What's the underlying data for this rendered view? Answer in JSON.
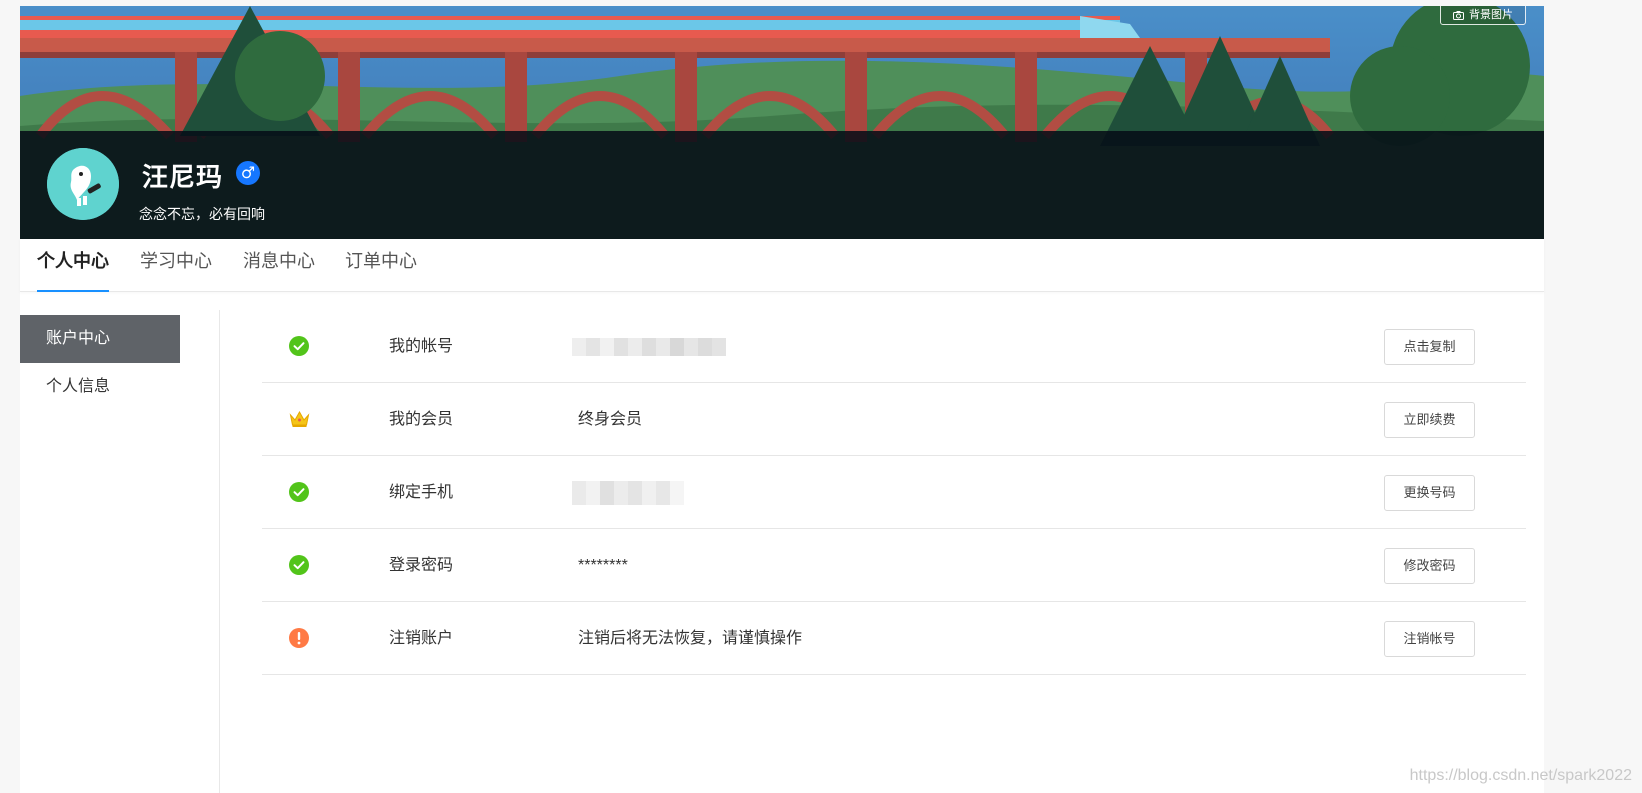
{
  "header": {
    "bg_button_label": "背景图片",
    "username": "汪尼玛",
    "gender_symbol": "♂",
    "motto": "念念不忘，必有回响"
  },
  "tabs": [
    {
      "label": "个人中心",
      "active": true
    },
    {
      "label": "学习中心",
      "active": false
    },
    {
      "label": "消息中心",
      "active": false
    },
    {
      "label": "订单中心",
      "active": false
    }
  ],
  "sidebar": {
    "items": [
      {
        "label": "账户中心",
        "active": true
      },
      {
        "label": "个人信息",
        "active": false
      }
    ]
  },
  "account": {
    "rows": [
      {
        "icon": "check-circle-icon",
        "label": "我的帐号",
        "value": "",
        "masked": true,
        "action": "点击复制"
      },
      {
        "icon": "crown-icon",
        "label": "我的会员",
        "value": "终身会员",
        "masked": false,
        "action": "立即续费"
      },
      {
        "icon": "check-circle-icon",
        "label": "绑定手机",
        "value": "",
        "masked": true,
        "action": "更换号码"
      },
      {
        "icon": "check-circle-icon",
        "label": "登录密码",
        "value": "********",
        "masked": false,
        "action": "修改密码"
      },
      {
        "icon": "warning-circle-icon",
        "label": "注销账户",
        "value": "注销后将无法恢复，请谨慎操作",
        "masked": false,
        "action": "注销帐号"
      }
    ]
  },
  "watermark": "https://blog.csdn.net/spark2022",
  "colors": {
    "accent": "#1890ff",
    "success": "#52c41a",
    "warning": "#ff7a45",
    "crown": "#f5c518",
    "sidebar_active_bg": "#5f6368",
    "avatar_bg": "#5fd3cf"
  }
}
